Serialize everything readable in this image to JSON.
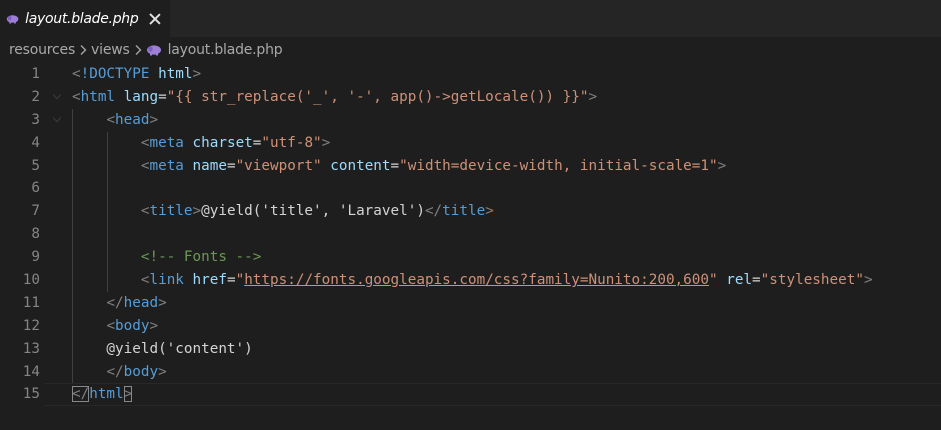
{
  "tab": {
    "label": "layout.blade.php",
    "icon": "php-elephant-icon",
    "icon_color": "#9d7fd6"
  },
  "breadcrumb": {
    "items": [
      "resources",
      "views"
    ],
    "file": "layout.blade.php"
  },
  "editor": {
    "lines": [
      {
        "n": "1",
        "tokens": [
          [
            "punc",
            "<"
          ],
          [
            "doc",
            "!DOCTYPE"
          ],
          [
            "text",
            " "
          ],
          [
            "attr",
            "html"
          ],
          [
            "punc",
            ">"
          ]
        ]
      },
      {
        "n": "2",
        "tokens": [
          [
            "punc",
            "<"
          ],
          [
            "tag",
            "html"
          ],
          [
            "text",
            " "
          ],
          [
            "attr",
            "lang"
          ],
          [
            "eq",
            "="
          ],
          [
            "str",
            "\"{{ str_replace('_', '-', app()->getLocale()) }}\""
          ],
          [
            "punc",
            ">"
          ]
        ]
      },
      {
        "n": "3",
        "tokens": [
          [
            "text",
            "    "
          ],
          [
            "punc",
            "<"
          ],
          [
            "tag",
            "head"
          ],
          [
            "punc",
            ">"
          ]
        ]
      },
      {
        "n": "4",
        "tokens": [
          [
            "text",
            "        "
          ],
          [
            "punc",
            "<"
          ],
          [
            "tag",
            "meta"
          ],
          [
            "text",
            " "
          ],
          [
            "attr",
            "charset"
          ],
          [
            "eq",
            "="
          ],
          [
            "str",
            "\"utf-8\""
          ],
          [
            "punc",
            ">"
          ]
        ]
      },
      {
        "n": "5",
        "tokens": [
          [
            "text",
            "        "
          ],
          [
            "punc",
            "<"
          ],
          [
            "tag",
            "meta"
          ],
          [
            "text",
            " "
          ],
          [
            "attr",
            "name"
          ],
          [
            "eq",
            "="
          ],
          [
            "str",
            "\"viewport\""
          ],
          [
            "text",
            " "
          ],
          [
            "attr",
            "content"
          ],
          [
            "eq",
            "="
          ],
          [
            "str",
            "\"width=device-width, initial-scale=1\""
          ],
          [
            "punc",
            ">"
          ]
        ]
      },
      {
        "n": "6",
        "tokens": []
      },
      {
        "n": "7",
        "tokens": [
          [
            "text",
            "        "
          ],
          [
            "punc",
            "<"
          ],
          [
            "tag",
            "title"
          ],
          [
            "punc",
            ">"
          ],
          [
            "text",
            "@yield('title', 'Laravel')"
          ],
          [
            "punc",
            "</"
          ],
          [
            "tag",
            "title"
          ],
          [
            "punc",
            ">"
          ]
        ]
      },
      {
        "n": "8",
        "tokens": []
      },
      {
        "n": "9",
        "tokens": [
          [
            "text",
            "        "
          ],
          [
            "cmt",
            "<!-- Fonts -->"
          ]
        ]
      },
      {
        "n": "10",
        "tokens": [
          [
            "text",
            "        "
          ],
          [
            "punc",
            "<"
          ],
          [
            "tag",
            "link"
          ],
          [
            "text",
            " "
          ],
          [
            "attr",
            "href"
          ],
          [
            "eq",
            "="
          ],
          [
            "str",
            "\""
          ],
          [
            "url",
            "https://fonts.googleapis.com/css?family=Nunito:200,600"
          ],
          [
            "str",
            "\""
          ],
          [
            "text",
            " "
          ],
          [
            "attr",
            "rel"
          ],
          [
            "eq",
            "="
          ],
          [
            "str",
            "\"stylesheet\""
          ],
          [
            "punc",
            ">"
          ]
        ]
      },
      {
        "n": "11",
        "tokens": [
          [
            "text",
            "    "
          ],
          [
            "punc",
            "</"
          ],
          [
            "tag",
            "head"
          ],
          [
            "punc",
            ">"
          ]
        ]
      },
      {
        "n": "12",
        "tokens": [
          [
            "text",
            "    "
          ],
          [
            "punc",
            "<"
          ],
          [
            "tag",
            "body"
          ],
          [
            "punc",
            ">"
          ]
        ]
      },
      {
        "n": "13",
        "tokens": [
          [
            "text",
            "    @yield('content')"
          ]
        ]
      },
      {
        "n": "14",
        "tokens": [
          [
            "text",
            "    "
          ],
          [
            "punc",
            "</"
          ],
          [
            "tag",
            "body"
          ],
          [
            "punc",
            ">"
          ]
        ]
      },
      {
        "n": "15",
        "tokens": [
          [
            "punc",
            "</"
          ],
          [
            "tag",
            "html"
          ],
          [
            "punc",
            ">"
          ]
        ]
      }
    ]
  }
}
